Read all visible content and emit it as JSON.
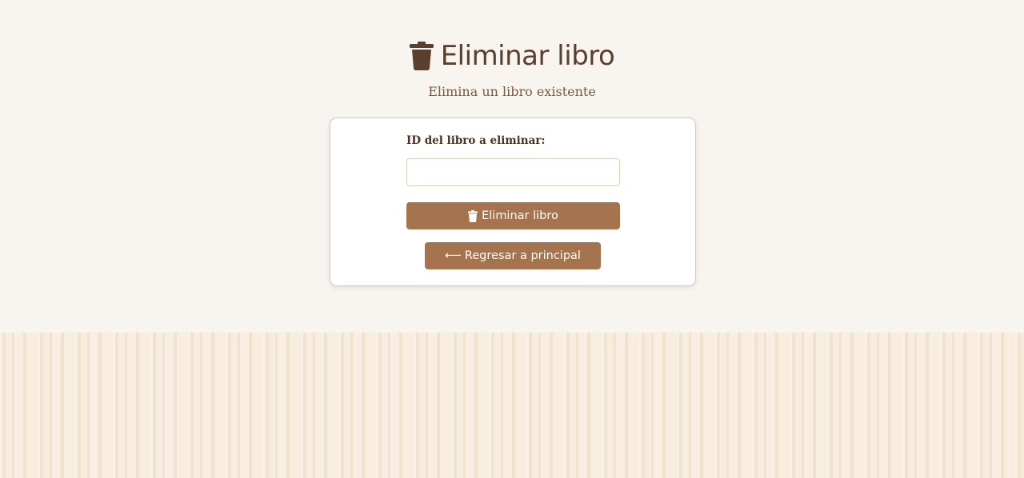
{
  "header": {
    "title": "Eliminar libro",
    "icon": "trash-icon",
    "subtitle": "Elimina un libro existente"
  },
  "form": {
    "id_label": "ID del libro a eliminar:",
    "id_value": "",
    "id_placeholder": "",
    "delete_button_label": "Eliminar libro",
    "delete_button_icon": "trash-icon",
    "back_arrow": "⟵",
    "back_button_label": "Regresar a principal"
  },
  "colors": {
    "title": "#5a3e2e",
    "button": "#a5744e",
    "background": "#f8f4ef",
    "wood": "#f6ead8"
  }
}
